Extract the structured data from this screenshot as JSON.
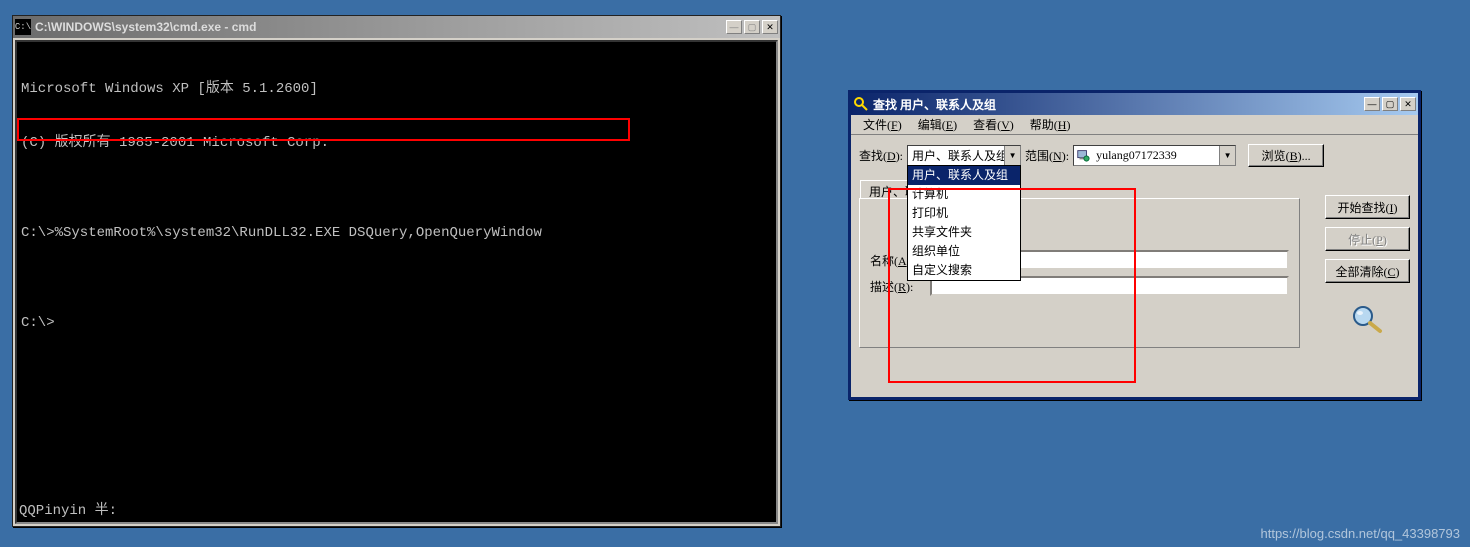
{
  "cmd": {
    "title": "C:\\WINDOWS\\system32\\cmd.exe - cmd",
    "icon_label": "C:\\",
    "lines": [
      "Microsoft Windows XP [版本 5.1.2600]",
      "(C) 版权所有 1985-2001 Microsoft Corp.",
      "",
      "C:\\>%SystemRoot%\\system32\\RunDLL32.EXE DSQuery,OpenQueryWindow",
      "",
      "C:\\>"
    ],
    "ime_status": "QQPinyin 半:"
  },
  "find": {
    "title": "查找 用户、联系人及组",
    "menus": [
      {
        "label": "文件",
        "mnemonic": "F"
      },
      {
        "label": "编辑",
        "mnemonic": "E"
      },
      {
        "label": "查看",
        "mnemonic": "V"
      },
      {
        "label": "帮助",
        "mnemonic": "H"
      }
    ],
    "find_label": "查找",
    "find_mnemonic": "D",
    "find_selected": "用户、联系人及组",
    "scope_label": "范围",
    "scope_mnemonic": "N",
    "scope_value": "yulang07172339",
    "browse_btn": "浏览",
    "browse_mnemonic": "B",
    "tab_label": "用户、联系人及组",
    "name_label": "名称",
    "name_mnemonic": "A",
    "desc_label": "描述",
    "desc_mnemonic": "R",
    "dd_options": [
      "用户、联系人及组",
      "计算机",
      "打印机",
      "共享文件夹",
      "组织单位",
      "自定义搜索"
    ],
    "buttons": {
      "start": "开始查找",
      "start_m": "I",
      "stop": "停止",
      "stop_m": "P",
      "clear": "全部清除",
      "clear_m": "C"
    }
  },
  "watermark": "https://blog.csdn.net/qq_43398793"
}
